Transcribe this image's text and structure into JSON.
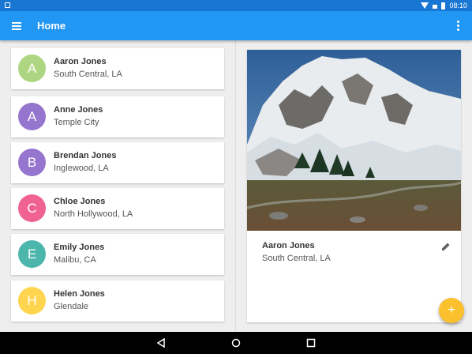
{
  "status_bar": {
    "time": "08:10"
  },
  "app_bar": {
    "title": "Home"
  },
  "contacts": [
    {
      "initial": "A",
      "name": "Aaron Jones",
      "location": "South Central, LA",
      "color": "#aed581"
    },
    {
      "initial": "A",
      "name": "Anne Jones",
      "location": "Temple City",
      "color": "#9575cd"
    },
    {
      "initial": "B",
      "name": "Brendan Jones",
      "location": "Inglewood, LA",
      "color": "#9575cd"
    },
    {
      "initial": "C",
      "name": "Chloe Jones",
      "location": "North Hollywood, LA",
      "color": "#f06292"
    },
    {
      "initial": "E",
      "name": "Emily Jones",
      "location": "Malibu, CA",
      "color": "#4db6ac"
    },
    {
      "initial": "H",
      "name": "Helen Jones",
      "location": "Glendale",
      "color": "#ffd54f"
    }
  ],
  "detail": {
    "name": "Aaron Jones",
    "location": "South Central, LA"
  },
  "fab": {
    "label": "+"
  },
  "colors": {
    "primary": "#2196f3",
    "primary_dark": "#1976d2",
    "accent": "#fbc02d"
  },
  "icons": [
    "menu-icon",
    "more-vert-icon",
    "edit-icon",
    "add-icon",
    "back-icon",
    "home-icon",
    "recents-icon",
    "wifi-icon",
    "battery-icon"
  ]
}
